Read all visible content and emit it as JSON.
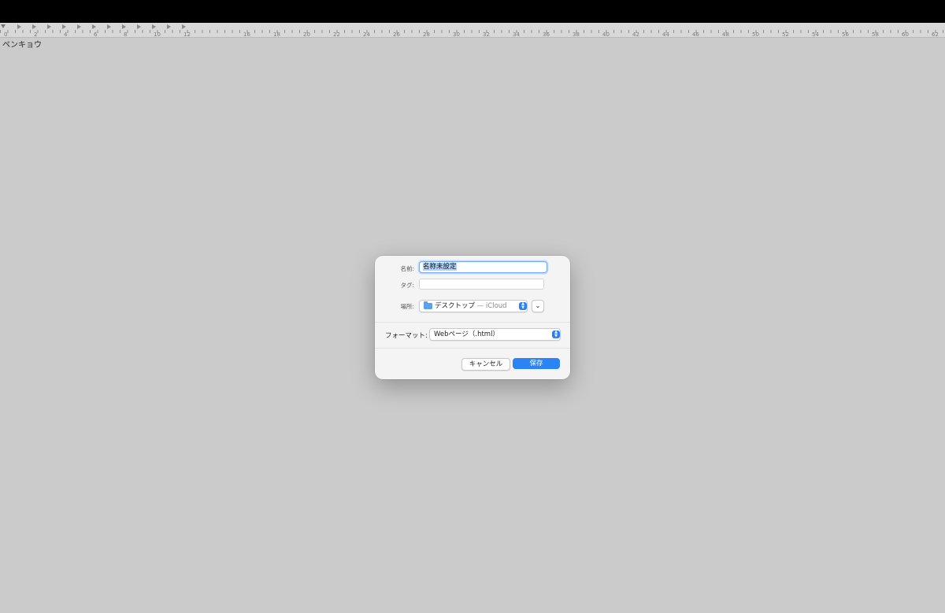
{
  "document": {
    "body_text": "ペンキョウ"
  },
  "ruler": {
    "numbers": [
      "0",
      "2",
      "4",
      "6",
      "8",
      "10",
      "12",
      "16",
      "18",
      "20",
      "22",
      "24",
      "26",
      "28",
      "30",
      "32",
      "34",
      "36",
      "38",
      "40",
      "42",
      "44",
      "46",
      "48",
      "50",
      "52",
      "54",
      "56",
      "58",
      "60",
      "62"
    ]
  },
  "save_dialog": {
    "name_label": "名前:",
    "name_value": "名称未設定",
    "tags_label": "タグ:",
    "location_label": "場所:",
    "location_value": "デスクトップ",
    "location_suffix": " — iCloud",
    "location_icon": "folder-icon",
    "format_label": "フォーマット:",
    "format_value": "Webページ（.html）",
    "cancel_label": "キャンセル",
    "save_label": "保存",
    "accent_color": "#2b84f5"
  }
}
